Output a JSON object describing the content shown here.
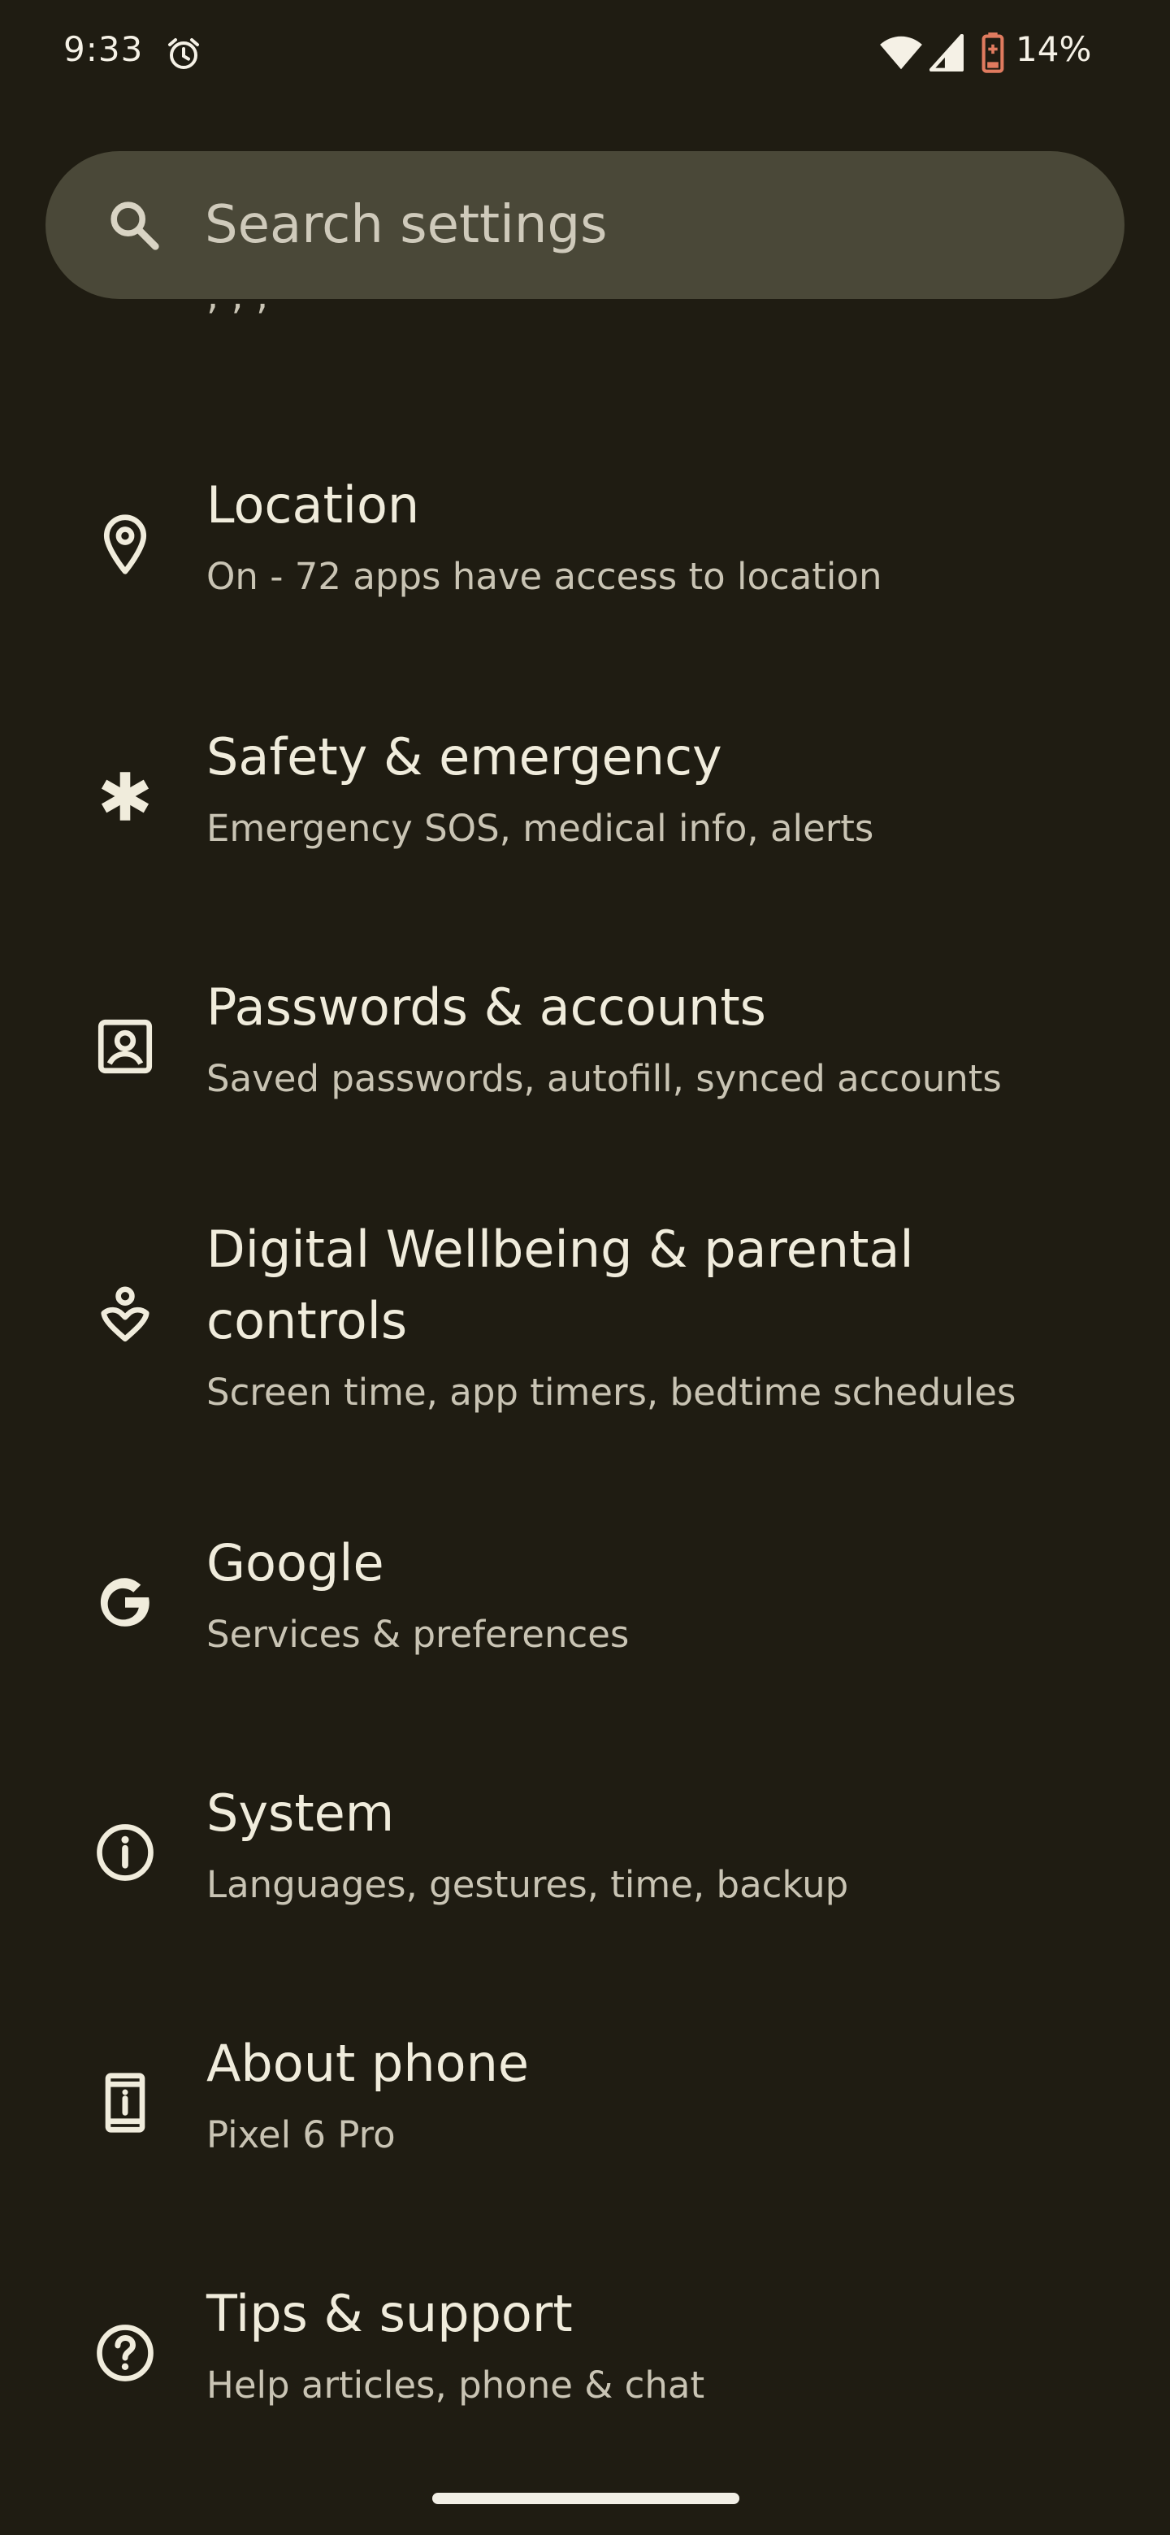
{
  "status_bar": {
    "time": "9:33",
    "battery_percent": "14%",
    "icons": [
      "alarm-icon",
      "wifi-icon",
      "cell-signal-icon",
      "battery-low-icon"
    ],
    "battery_color": "#e07b5f"
  },
  "search": {
    "placeholder": "Search settings"
  },
  "clipped_item": {
    "summary": ", ,      ,"
  },
  "colors": {
    "background": "#1f1c12",
    "search_bg": "#4a4838",
    "title": "#f0ecdc",
    "summary": "#c9c4b4"
  },
  "settings": [
    {
      "icon": "location-pin-icon",
      "title": "Location",
      "summary": "On - 72 apps have access to location"
    },
    {
      "icon": "asterisk-icon",
      "title": "Safety & emergency",
      "summary": "Emergency SOS, medical info, alerts"
    },
    {
      "icon": "account-box-icon",
      "title": "Passwords & accounts",
      "summary": "Saved passwords, autofill, synced accounts"
    },
    {
      "icon": "wellbeing-icon",
      "title": "Digital Wellbeing & parental controls",
      "summary": "Screen time, app timers, bedtime schedules"
    },
    {
      "icon": "google-icon",
      "title": "Google",
      "summary": "Services & preferences"
    },
    {
      "icon": "info-icon",
      "title": "System",
      "summary": "Languages, gestures, time, backup"
    },
    {
      "icon": "phone-info-icon",
      "title": "About phone",
      "summary": "Pixel 6 Pro"
    },
    {
      "icon": "help-icon",
      "title": "Tips & support",
      "summary": "Help articles, phone & chat"
    }
  ]
}
